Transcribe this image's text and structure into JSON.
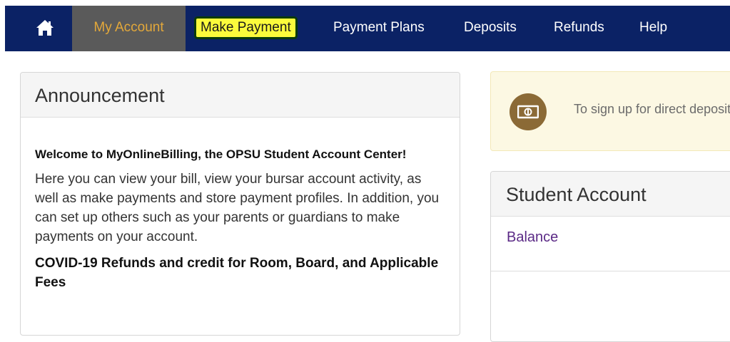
{
  "nav": {
    "home_icon": "home-icon",
    "items": [
      {
        "label": "My Account"
      },
      {
        "label": "Make Payment"
      },
      {
        "label": "Payment Plans"
      },
      {
        "label": "Deposits"
      },
      {
        "label": "Refunds"
      },
      {
        "label": "Help"
      }
    ],
    "colors": {
      "navbar": "#0b2265",
      "active_bg": "#5a5a5a",
      "active_text": "#e3a83a",
      "highlight": "#fbfb3c"
    }
  },
  "announcement": {
    "title": "Announcement",
    "welcome": "Welcome to MyOnlineBilling, the OPSU Student Account Center!",
    "body": "Here you can view your bill, view your bursar account activity, as well as make payments and store payment profiles. In addition, you can set up others such as your parents or guardians to make payments on your account.",
    "covid": "COVID-19 Refunds and credit for Room, Board, and Applicable Fees"
  },
  "notice": {
    "icon": "money-icon",
    "text": "To sign up for direct deposit"
  },
  "student_account": {
    "title": "Student Account",
    "balance_label": "Balance"
  }
}
